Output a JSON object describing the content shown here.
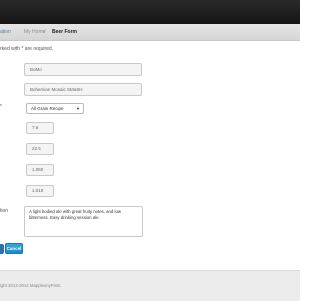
{
  "breadcrumb": {
    "start": "ation",
    "home": "My Home",
    "separator": "/",
    "current": "Beer Form"
  },
  "form": {
    "required_note": "rked with * are required.",
    "fields": {
      "abbr": {
        "value": "BoMo"
      },
      "name": {
        "value": "Bohemian Mosaic SMaSH"
      },
      "type": {
        "label": "*",
        "selected": "All Grain Recipe"
      },
      "value1": {
        "value": "7.6"
      },
      "value2": {
        "value": "22.5"
      },
      "value3": {
        "value": "1.050"
      },
      "value4": {
        "value": "1.010"
      },
      "description": {
        "label": "tion",
        "value": "A light bodied ale with great fruity notes, and low bitterness. Easy drinking session ale."
      }
    },
    "cancel_label": "Cancel"
  },
  "footer": {
    "text": "ight 2013-2014 MappleonyPints"
  },
  "colors": {
    "topbar": "#1c1c1c",
    "cancel_button": "#2a9fd6",
    "submit_button": "#2f6fb6"
  }
}
